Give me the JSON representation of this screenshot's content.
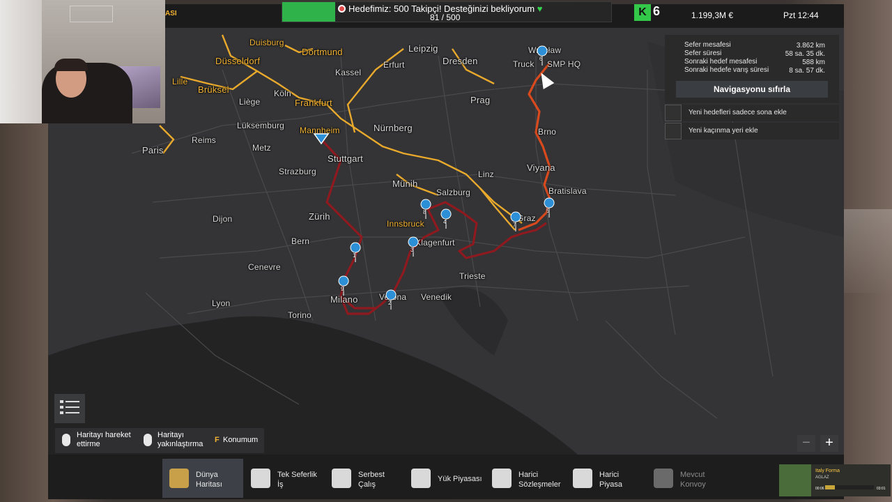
{
  "top": {
    "left_label": "ASI",
    "goal_text": "Hedefimiz: 500 Takipçi! Desteğinizi bekliyorum",
    "goal_heart": "♥",
    "goal_count": "81 / 500",
    "goal_progress": 0.162,
    "level_glyph": "K",
    "level": "6",
    "money": "1.199,3M €",
    "clock": "Pzt 12:44"
  },
  "nav": {
    "rows": [
      {
        "label": "Sefer mesafesi",
        "value": "3.862 km"
      },
      {
        "label": "Sefer süresi",
        "value": "58 sa. 35 dk."
      },
      {
        "label": "Sonraki hedef mesafesi",
        "value": "588 km"
      },
      {
        "label": "Sonraki hedefe varış süresi",
        "value": "8 sa. 57 dk."
      }
    ],
    "reset_button": "Navigasyonu sıfırla",
    "check1": "Yeni hedefleri sadece sona ekle",
    "check2": "Yeni kaçınma yeri ekle"
  },
  "map": {
    "cities": [
      "Duisburg",
      "Dortmund",
      "Düsseldorf",
      "Lille",
      "Brüksel",
      "Köln",
      "Kassel",
      "Leipzig",
      "Erfurt",
      "Dresden",
      "Wrocław",
      "Truck",
      "SMP HQ",
      "Liège",
      "Frankfurt",
      "Prag",
      "Lüksemburg",
      "Mannheim",
      "Nürnberg",
      "Brno",
      "Paris",
      "Reims",
      "Metz",
      "Stuttgart",
      "Viyana",
      "Strazburg",
      "Linz",
      "Münih",
      "Salzburg",
      "Bratislava",
      "Dijon",
      "Zürih",
      "Innsbruck",
      "Graz",
      "Bern",
      "Klagenfurt",
      "Cenevre",
      "Trieste",
      "Lyon",
      "Milano",
      "Verona",
      "Venedik",
      "Torino"
    ],
    "waypoints": [
      "1",
      "2",
      "3",
      "4",
      "5",
      "6",
      "7",
      "8",
      "9"
    ],
    "route_colors": {
      "route": "#8e1a1f",
      "next": "#d84a1e",
      "highways": "#e8a92c"
    }
  },
  "hints": {
    "move": "Haritayı hareket ettirme",
    "zoom": "Haritayı yakınlaştırma",
    "key": "F",
    "position": "Konumum"
  },
  "zoom": {
    "minus": "−",
    "plus": "+"
  },
  "tabs": [
    {
      "label": "Dünya Haritası",
      "icon": "world-map-icon"
    },
    {
      "label": "Tek Seferlik İş",
      "icon": "clock-icon"
    },
    {
      "label": "Serbest Çalış",
      "icon": "freelance-icon"
    },
    {
      "label": "Yük Piyasası",
      "icon": "cargo-icon"
    },
    {
      "label": "Harici Sözleşmeler",
      "icon": "globe-contracts-icon"
    },
    {
      "label": "Harici Piyasa",
      "icon": "globe-market-icon"
    },
    {
      "label": "Mevcut Konvoy",
      "icon": "convoy-icon"
    }
  ],
  "music": {
    "title": "Italy Forma",
    "sub": "AGLAZ",
    "elapsed": "00:06",
    "total": "03:01",
    "progress": 0.2
  }
}
